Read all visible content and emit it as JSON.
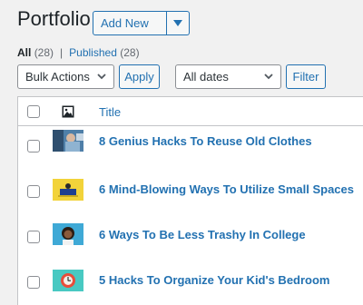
{
  "header": {
    "title": "Portfolio",
    "add_new_label": "Add New"
  },
  "views": [
    {
      "label": "All",
      "count": "(28)",
      "current": true
    },
    {
      "label": "Published",
      "count": "(28)",
      "current": false
    }
  ],
  "views_separator": "|",
  "filters": {
    "bulk_actions": "Bulk Actions",
    "apply_label": "Apply",
    "date_filter": "All dates",
    "filter_label": "Filter"
  },
  "table": {
    "columns": {
      "title": "Title"
    },
    "rows": [
      {
        "title": "8 Genius Hacks To Reuse Old Clothes",
        "thumb": "clothes"
      },
      {
        "title": "6 Mind-Blowing Ways To Utilize Small Spaces",
        "thumb": "yellow-space"
      },
      {
        "title": "6 Ways To Be Less Trashy In College",
        "thumb": "student"
      },
      {
        "title": "5 Hacks To Organize Your Kid's Bedroom",
        "thumb": "kids-room"
      }
    ]
  },
  "colors": {
    "link": "#2271b1",
    "text": "#1d2327",
    "background": "#f1f1f1",
    "border": "#c3c4c7"
  }
}
